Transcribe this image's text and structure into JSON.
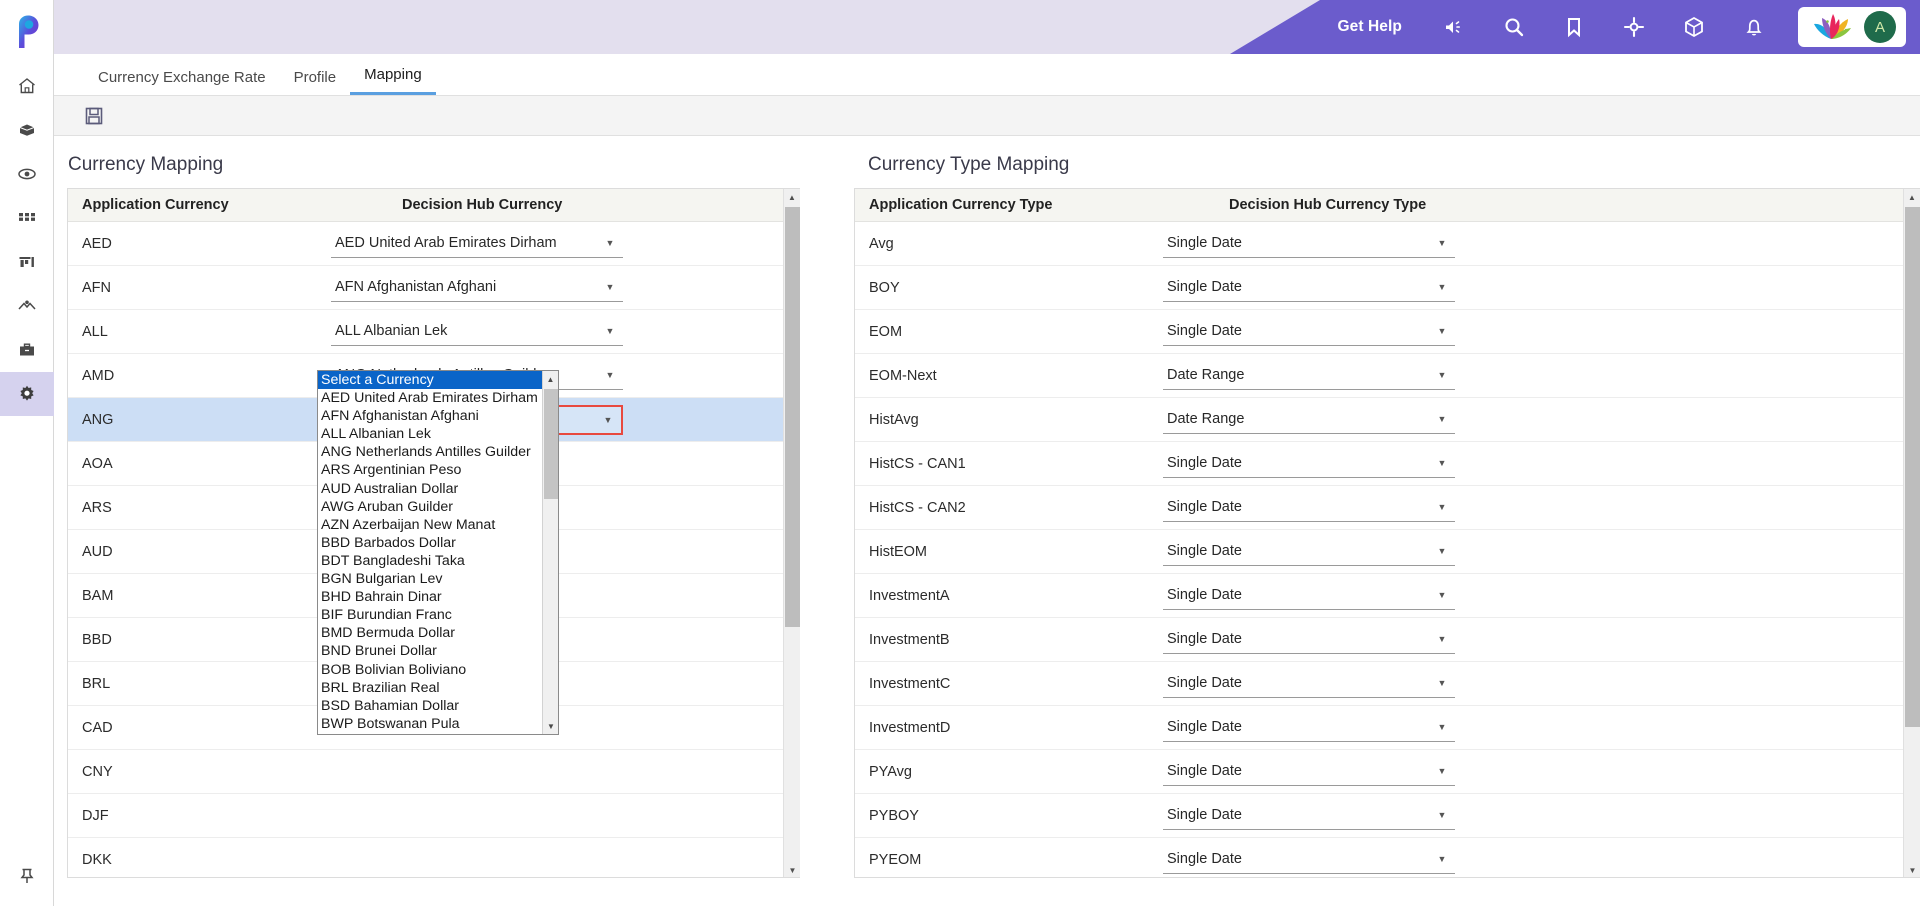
{
  "app": {
    "logo_name": "pega-logo",
    "header": {
      "get_help_label": "Get Help",
      "icons": [
        "announcement-icon",
        "search-icon",
        "bookmark-icon",
        "target-icon",
        "cube-icon",
        "bell-icon"
      ],
      "brand_mark": "lotus-logo",
      "avatar_initial": "A",
      "accent_purple": "#6b5ccc",
      "header_bg": "#e3dfee"
    },
    "rail_icons": [
      "home-icon",
      "package-icon",
      "eye-icon",
      "apps-grid-icon",
      "chart-icon",
      "pipeline-icon",
      "briefcase-icon",
      "gear-icon"
    ],
    "rail_active_index": 7,
    "rail_pin_icon": "pin-icon"
  },
  "tabs": [
    {
      "label": "Currency Exchange Rate",
      "active": false
    },
    {
      "label": "Profile",
      "active": false
    },
    {
      "label": "Mapping",
      "active": true
    }
  ],
  "toolbar": {
    "save_icon": "save-icon"
  },
  "left_panel": {
    "title": "Currency Mapping",
    "columns": [
      "Application Currency",
      "Decision Hub Currency"
    ],
    "rows": [
      {
        "code": "AED",
        "value": "AED United Arab Emirates Dirham",
        "selected": false
      },
      {
        "code": "AFN",
        "value": "AFN Afghanistan Afghani",
        "selected": false
      },
      {
        "code": "ALL",
        "value": "ALL Albanian Lek",
        "selected": false
      },
      {
        "code": "AMD",
        "value": "ANG Netherlands Antilles Guilder",
        "selected": false
      },
      {
        "code": "ANG",
        "value": "Select a Currency",
        "selected": true
      },
      {
        "code": "AOA",
        "value": "",
        "selected": false
      },
      {
        "code": "ARS",
        "value": "",
        "selected": false
      },
      {
        "code": "AUD",
        "value": "",
        "selected": false
      },
      {
        "code": "BAM",
        "value": "",
        "selected": false
      },
      {
        "code": "BBD",
        "value": "",
        "selected": false
      },
      {
        "code": "BRL",
        "value": "",
        "selected": false
      },
      {
        "code": "CAD",
        "value": "",
        "selected": false
      },
      {
        "code": "CNY",
        "value": "",
        "selected": false
      },
      {
        "code": "DJF",
        "value": "",
        "selected": false
      },
      {
        "code": "DKK",
        "value": "",
        "selected": false
      }
    ]
  },
  "dropdown": {
    "open": true,
    "selected_option": "Select a Currency",
    "options": [
      "Select a Currency",
      "AED United Arab Emirates Dirham",
      "AFN Afghanistan Afghani",
      "ALL Albanian Lek",
      "ANG Netherlands Antilles Guilder",
      "ARS Argentinian Peso",
      "AUD Australian Dollar",
      "AWG Aruban Guilder",
      "AZN Azerbaijan New Manat",
      "BBD Barbados Dollar",
      "BDT Bangladeshi Taka",
      "BGN Bulgarian Lev",
      "BHD Bahrain Dinar",
      "BIF Burundian Franc",
      "BMD Bermuda Dollar",
      "BND Brunei Dollar",
      "BOB Bolivian Boliviano",
      "BRL Brazilian Real",
      "BSD Bahamian Dollar",
      "BWP Botswanan Pula"
    ]
  },
  "right_panel": {
    "title": "Currency Type Mapping",
    "columns": [
      "Application Currency Type",
      "Decision Hub Currency Type"
    ],
    "rows": [
      {
        "code": "Avg",
        "value": "Single Date"
      },
      {
        "code": "BOY",
        "value": "Single Date"
      },
      {
        "code": "EOM",
        "value": "Single Date"
      },
      {
        "code": "EOM-Next",
        "value": "Date Range"
      },
      {
        "code": "HistAvg",
        "value": "Date Range"
      },
      {
        "code": "HistCS - CAN1",
        "value": "Single Date"
      },
      {
        "code": "HistCS - CAN2",
        "value": "Single Date"
      },
      {
        "code": "HistEOM",
        "value": "Single Date"
      },
      {
        "code": "InvestmentA",
        "value": "Single Date"
      },
      {
        "code": "InvestmentB",
        "value": "Single Date"
      },
      {
        "code": "InvestmentC",
        "value": "Single Date"
      },
      {
        "code": "InvestmentD",
        "value": "Single Date"
      },
      {
        "code": "PYAvg",
        "value": "Single Date"
      },
      {
        "code": "PYBOY",
        "value": "Single Date"
      },
      {
        "code": "PYEOM",
        "value": "Single Date"
      }
    ]
  },
  "colors": {
    "selected_row": "#ccdef5",
    "highlight_border": "#e8493f",
    "dropdown_selected": "#0a64c8",
    "tab_underline": "#5a9fe0"
  }
}
